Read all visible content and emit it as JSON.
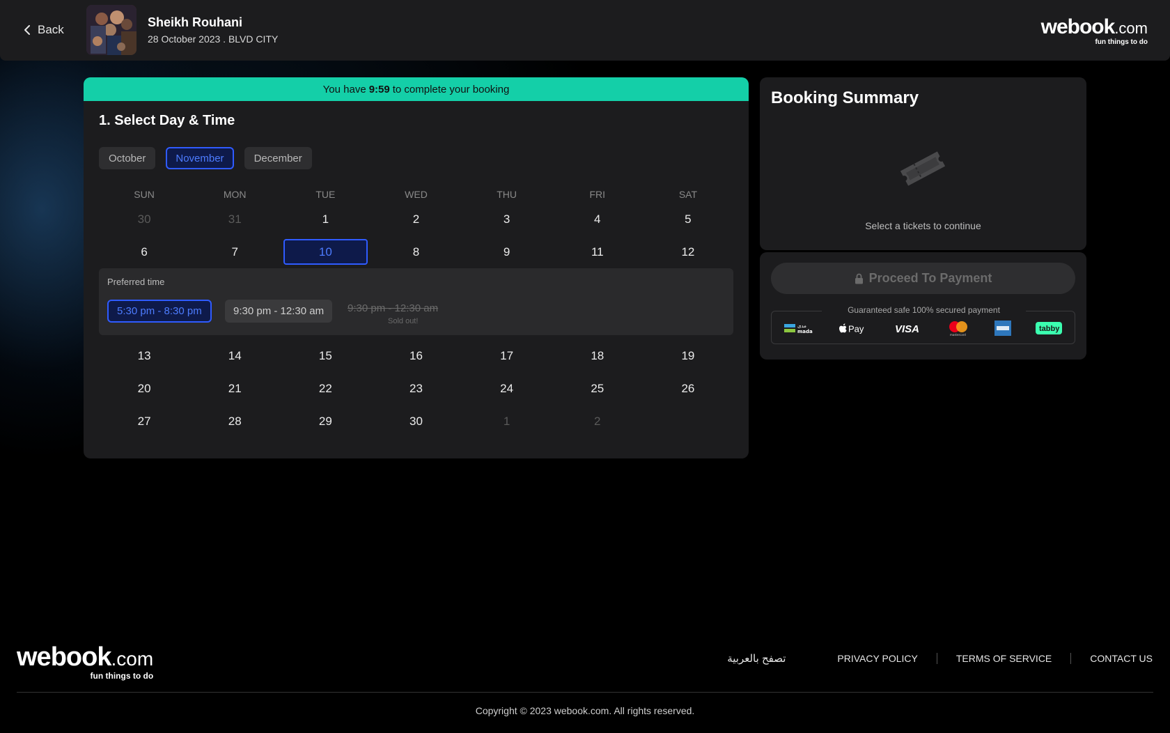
{
  "header": {
    "back_label": "Back",
    "event_title": "Sheikh Rouhani",
    "event_subtitle": "28 October 2023 . BLVD CITY",
    "logo_word": "webook",
    "logo_com": ".com",
    "logo_tagline": "fun things to do"
  },
  "booking": {
    "timer_prefix": "You have",
    "timer_value": "9:59",
    "timer_suffix": "to complete your booking",
    "step_title": "1. Select Day & Time",
    "months": [
      {
        "label": "October",
        "active": false
      },
      {
        "label": "November",
        "active": true
      },
      {
        "label": "December",
        "active": false
      }
    ],
    "weekdays": [
      "SUN",
      "MON",
      "TUE",
      "WED",
      "THU",
      "FRI",
      "SAT"
    ],
    "weeks_before": [
      [
        "30",
        "31",
        "1",
        "2",
        "3",
        "4",
        "5"
      ],
      [
        "6",
        "7",
        "10",
        "8",
        "9",
        "11",
        "12"
      ]
    ],
    "weeks_after": [
      [
        "13",
        "14",
        "15",
        "16",
        "17",
        "18",
        "19"
      ],
      [
        "20",
        "21",
        "22",
        "23",
        "24",
        "25",
        "26"
      ],
      [
        "27",
        "28",
        "29",
        "30",
        "1",
        "2",
        ""
      ]
    ],
    "selected_day": "10",
    "preferred_time_label": "Preferred time",
    "time_slots": [
      {
        "label": "5:30 pm - 8:30 pm",
        "state": "selected"
      },
      {
        "label": "9:30 pm - 12:30 am",
        "state": "available"
      },
      {
        "label": "9:30 pm - 12:30 am",
        "state": "sold-out"
      }
    ],
    "sold_out_label": "Sold out!"
  },
  "summary": {
    "title": "Booking Summary",
    "empty_text": "Select a tickets to continue",
    "pay_button": "Proceed To Payment",
    "secure_text": "Guaranteed safe 100% secured payment",
    "payment_methods": [
      "mada",
      "Apple Pay",
      "VISA",
      "mastercard",
      "American Express",
      "tabby"
    ]
  },
  "footer": {
    "logo_word": "webook",
    "logo_com": ".com",
    "logo_tagline": "fun things to do",
    "arabic_link": "تصفح بالعربية",
    "privacy": "PRIVACY POLICY",
    "terms": "TERMS OF SERVICE",
    "contact": "CONTACT US",
    "copyright": "Copyright © 2023 webook.com. All rights reserved."
  },
  "colors": {
    "timer_bar": "#14cfa8",
    "accent_blue": "#2f5bff",
    "panel": "#1c1c1e"
  }
}
